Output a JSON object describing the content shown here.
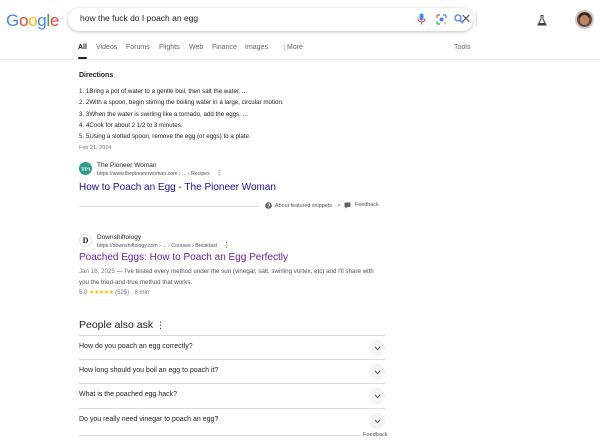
{
  "header": {
    "logo": "Google",
    "search_query": "how the fuck do I poach an egg"
  },
  "tabs": [
    {
      "label": "All"
    },
    {
      "label": "Videos"
    },
    {
      "label": "Forums"
    },
    {
      "label": "Flights"
    },
    {
      "label": "Web"
    },
    {
      "label": "Finance"
    },
    {
      "label": "Images"
    },
    {
      "label": "More"
    }
  ],
  "tools_label": "Tools",
  "featured": {
    "title": "Directions",
    "steps": [
      "1.  1Bring a pot of water to a gentle boil, then salt the water. ...",
      "2.  2With a spoon, begin stirring the boiling water in a large, circular motion.",
      "3.  3When the water is swirling like a tornado, add the eggs. ...",
      "4.  4Cook for about 2 1/2 to 3 minutes.",
      "5.  5Using a slotted spoon, remove the egg (or eggs) to a plate."
    ],
    "date": "Feb 21, 2024",
    "site_name": "The Pioneer Woman",
    "site_url": "https://www.thepioneerwoman.com › ... › Recipes",
    "result_title": "How to Poach an Egg - The Pioneer Woman",
    "about_label": "About featured snippets",
    "separator": "•",
    "feedback_label": "Feedback"
  },
  "result2": {
    "favicon_letter": "D",
    "site_name": "Downshiftology",
    "site_url": "https://downshiftology.com › ... › Courses › Breakfast",
    "title": "Poached Eggs: How to Poach an Egg Perfectly",
    "date": "Jan 16, 2025",
    "desc_rest": " — I've tested every method under the sun (vinegar, salt, swirling vortex, etc) and I'll share with you the tried-and-true method that works.",
    "rating_value": "5.0",
    "stars": "★★★★★",
    "reviews": "(525)",
    "time": "· 8 min"
  },
  "paa": {
    "title": "People also ask",
    "questions": [
      "How do you poach an egg correctly?",
      "How long should you boil an egg to poach it?",
      "What is the poached egg hack?",
      "Do you really need vinegar to poach an egg?"
    ],
    "feedback_label": "Feedback"
  },
  "colors": {
    "link": "#1a0dab",
    "visited": "#681da8",
    "pioneer_favicon": "#2e9c8c",
    "star": "#fbbc04"
  }
}
